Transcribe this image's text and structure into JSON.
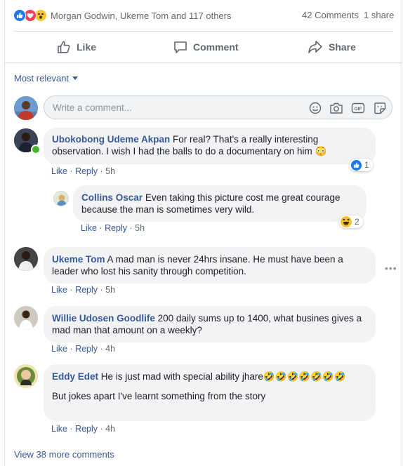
{
  "reactions": {
    "names": "Morgan Godwin, Ukeme Tom and 117 others",
    "comments_count": "42 Comments",
    "shares": "1 share",
    "icons": [
      "like-icon",
      "love-icon",
      "wow-icon"
    ]
  },
  "actions": {
    "like": "Like",
    "comment": "Comment",
    "share": "Share"
  },
  "sort": {
    "label": "Most relevant"
  },
  "composer": {
    "placeholder": "Write a comment..."
  },
  "comments": [
    {
      "author": "Ubokobong Udeme Akpan",
      "text": "For real? That's a really interesting observation. I wish I had the balls to do a documentary on him 😳",
      "like": "Like",
      "reply": "Reply",
      "time": "5h",
      "reaction_count": "1"
    },
    {
      "author": "Collins Oscar",
      "text": "Even taking this picture cost me great courage because the man is sometimes very wild.",
      "like": "Like",
      "reply": "Reply",
      "time": "5h",
      "reaction_count": "2"
    },
    {
      "author": "Ukeme Tom",
      "text": "A mad man is never 24hrs insane. He must have been a leader who lost his sanity through competition.",
      "like": "Like",
      "reply": "Reply",
      "time": "5h"
    },
    {
      "author": "Willie Udosen Goodlife",
      "text": "200 daily sums up to 1400, what busines gives a mad man that amount on a weekly?",
      "like": "Like",
      "reply": "Reply",
      "time": "4h"
    },
    {
      "author": "Eddy Edet",
      "text": "He is just mad with special ability jhare🤣🤣🤣🤣🤣🤣🤣",
      "text2": "But jokes apart I've learnt something from the story",
      "like": "Like",
      "reply": "Reply",
      "time": "4h"
    }
  ],
  "footer": {
    "more": "View 38 more comments"
  },
  "colors": {
    "link": "#385898",
    "like_blue": "#1877f2",
    "love_red": "#f33e58",
    "bubble": "#f2f3f5",
    "online_green": "#42b72a"
  }
}
